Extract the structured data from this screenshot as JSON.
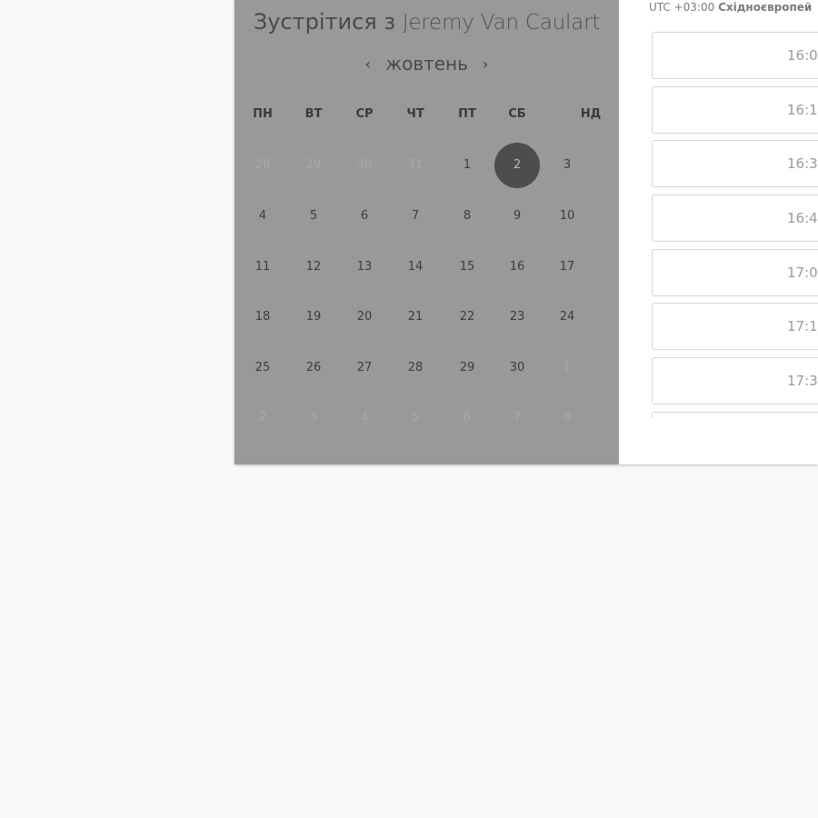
{
  "calendar": {
    "title_prefix": "Зустрітися з",
    "host_name": "Jeremy Van Caulart",
    "month": "жовтень",
    "prev_arrow": "‹",
    "next_arrow": "›",
    "weekdays": [
      "ПН",
      "ВТ",
      "СР",
      "ЧТ",
      "ПТ",
      "СБ",
      "НД"
    ],
    "weeks": [
      [
        {
          "d": "28",
          "m": true
        },
        {
          "d": "29",
          "m": true
        },
        {
          "d": "30",
          "m": true
        },
        {
          "d": "31",
          "m": true
        },
        {
          "d": "1"
        },
        {
          "d": "2",
          "sel": true
        },
        {
          "d": "3"
        }
      ],
      [
        {
          "d": "4"
        },
        {
          "d": "5"
        },
        {
          "d": "6"
        },
        {
          "d": "7"
        },
        {
          "d": "8"
        },
        {
          "d": "9"
        },
        {
          "d": "10"
        }
      ],
      [
        {
          "d": "11"
        },
        {
          "d": "12"
        },
        {
          "d": "13"
        },
        {
          "d": "14"
        },
        {
          "d": "15"
        },
        {
          "d": "16"
        },
        {
          "d": "17"
        }
      ],
      [
        {
          "d": "18"
        },
        {
          "d": "19"
        },
        {
          "d": "20"
        },
        {
          "d": "21"
        },
        {
          "d": "22"
        },
        {
          "d": "23"
        },
        {
          "d": "24"
        }
      ],
      [
        {
          "d": "25"
        },
        {
          "d": "26"
        },
        {
          "d": "27"
        },
        {
          "d": "28"
        },
        {
          "d": "29"
        },
        {
          "d": "30"
        },
        {
          "d": "1",
          "m": true
        }
      ],
      [
        {
          "d": "2",
          "m": true
        },
        {
          "d": "3",
          "m": true
        },
        {
          "d": "4",
          "m": true
        },
        {
          "d": "5",
          "m": true
        },
        {
          "d": "6",
          "m": true
        },
        {
          "d": "7",
          "m": true
        },
        {
          "d": "8",
          "m": true
        }
      ]
    ],
    "colors": {
      "overlay_panel": "#999999",
      "selected_day": "#4d4d4d"
    }
  },
  "times": {
    "timezone_offset": "UTC +03:00",
    "timezone_name": "Східноєвропей",
    "slots": [
      "16:0",
      "16:1",
      "16:3",
      "16:4",
      "17:0",
      "17:1",
      "17:3",
      ""
    ]
  }
}
